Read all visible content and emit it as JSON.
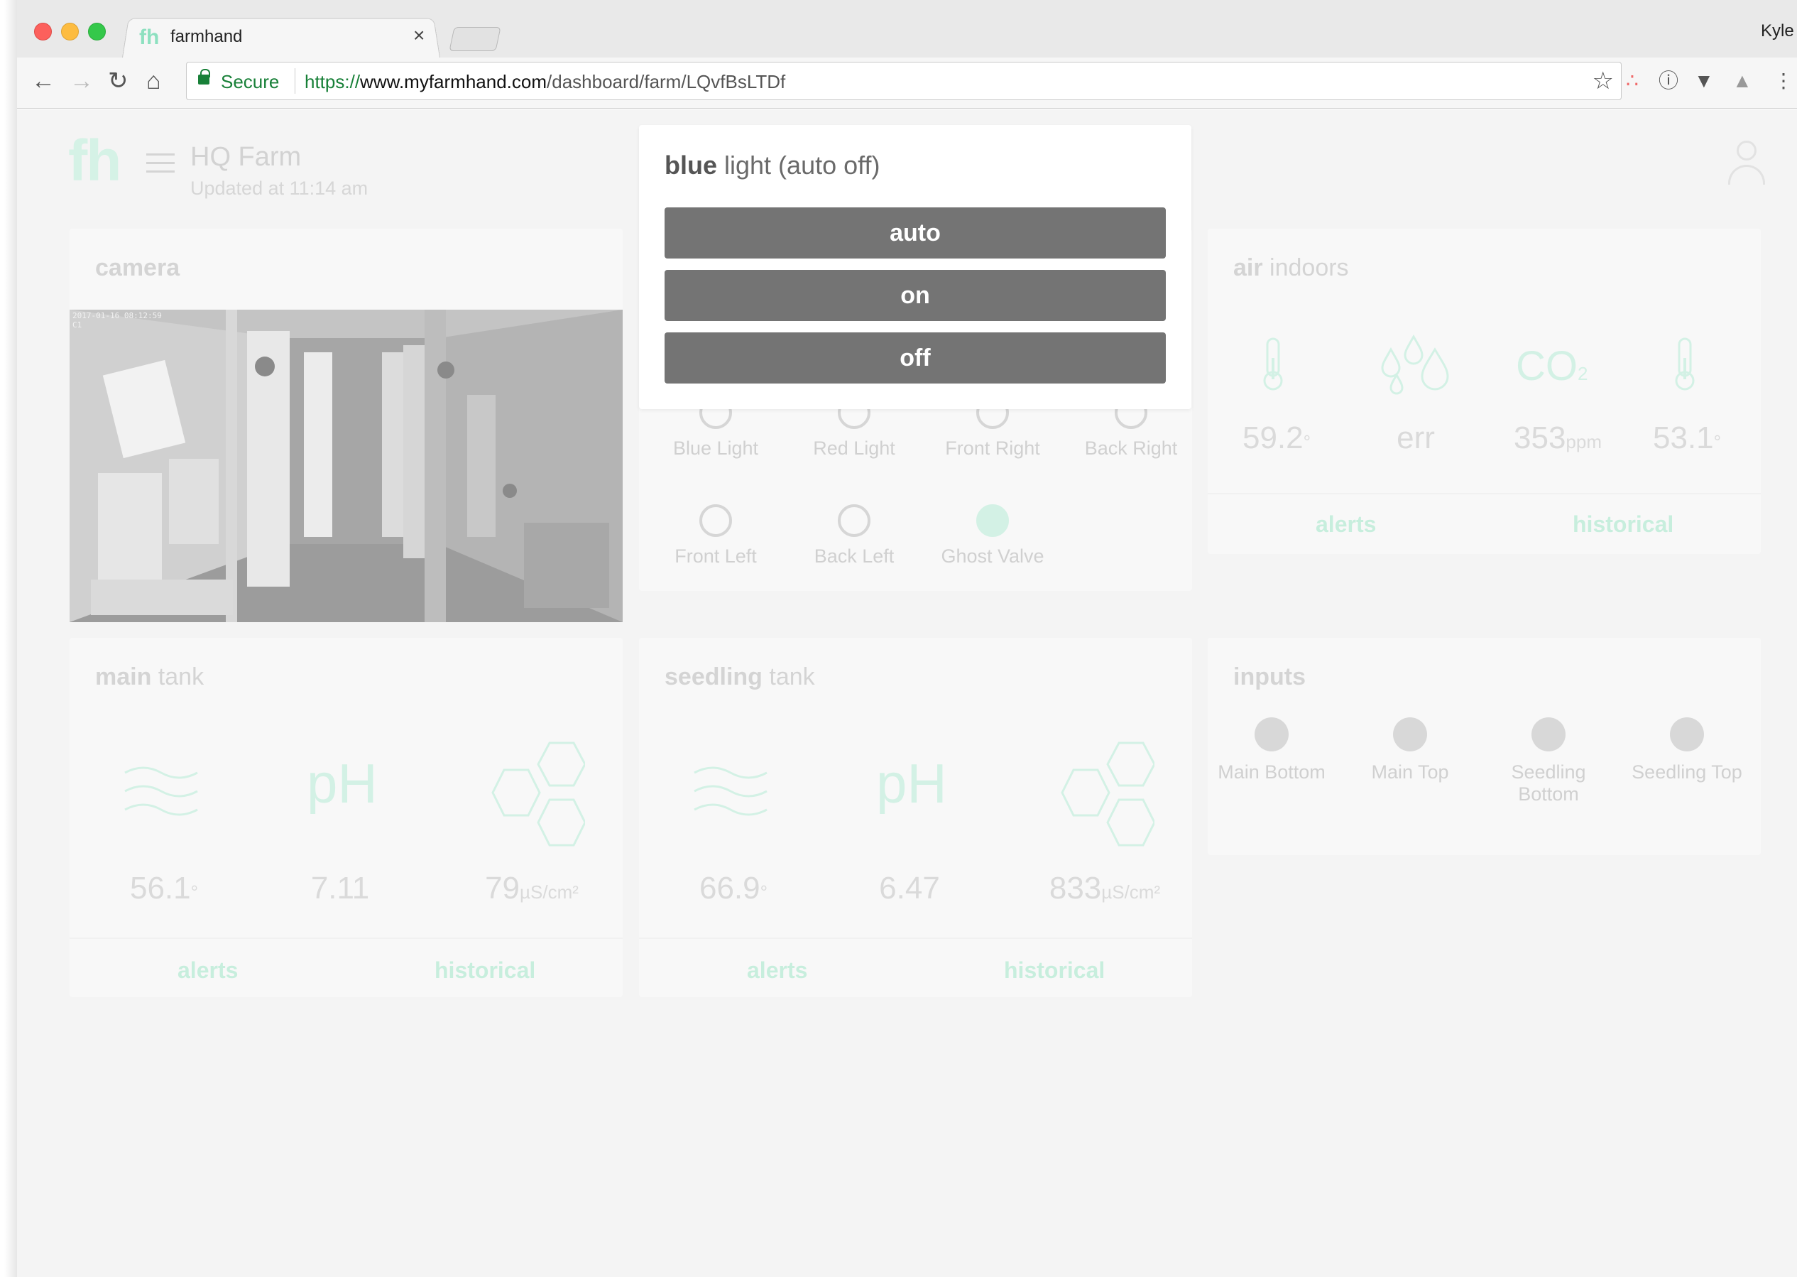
{
  "browser": {
    "tab_title": "farmhand",
    "tab_favicon": "fh",
    "tab_close": "×",
    "user_name": "Kyle",
    "secure_label": "Secure",
    "url_scheme": "https://",
    "url_host": "www.myfarmhand.com",
    "url_path": "/dashboard/farm/LQvfBsLTDf",
    "nav_icons": [
      "back-arrow-icon",
      "forward-arrow-icon",
      "reload-icon",
      "home-icon"
    ],
    "extension_icons": [
      "asana-icon",
      "info-icon",
      "pocket-icon",
      "drive-icon",
      "menu-dots-icon"
    ]
  },
  "header": {
    "logo": "fh",
    "farm_name": "HQ Farm",
    "updated": "Updated at 11:14 am"
  },
  "camera": {
    "title": "camera",
    "timestamp": "2017-01-16 08:12:59",
    "channel": "C1"
  },
  "popup": {
    "title_bold": "blue",
    "title_rest": " light (auto off)",
    "options": [
      "auto",
      "on",
      "off"
    ]
  },
  "relays": {
    "items": [
      {
        "label": "Blue Light",
        "on": false
      },
      {
        "label": "Red Light",
        "on": false
      },
      {
        "label": "Front Right",
        "on": false
      },
      {
        "label": "Back Right",
        "on": false
      },
      {
        "label": "Front Left",
        "on": false
      },
      {
        "label": "Back Left",
        "on": false
      },
      {
        "label": "Ghost Valve",
        "on": true
      }
    ]
  },
  "air": {
    "title_bold": "air",
    "title_rest": " indoors",
    "co2_label": "CO",
    "co2_sub": "2",
    "metrics": [
      {
        "value": "59.2",
        "unit": "°",
        "icon": "thermometer-icon"
      },
      {
        "value": "err",
        "unit": "",
        "icon": "humidity-drops-icon"
      },
      {
        "value": "353",
        "unit": "ppm",
        "icon": "co2-icon"
      },
      {
        "value": "53.1",
        "unit": "°",
        "icon": "thermometer-icon"
      }
    ],
    "alerts": "alerts",
    "historical": "historical"
  },
  "main_tank": {
    "title_bold": "main",
    "title_rest": " tank",
    "ph_label": "pH",
    "temp": {
      "value": "56.1",
      "unit": "°"
    },
    "ph": {
      "value": "7.11"
    },
    "ec": {
      "value": "79",
      "unit": "µS/cm²"
    },
    "alerts": "alerts",
    "historical": "historical"
  },
  "seedling_tank": {
    "title_bold": "seedling",
    "title_rest": " tank",
    "ph_label": "pH",
    "temp": {
      "value": "66.9",
      "unit": "°"
    },
    "ph": {
      "value": "6.47"
    },
    "ec": {
      "value": "833",
      "unit": "µS/cm²"
    },
    "alerts": "alerts",
    "historical": "historical"
  },
  "inputs": {
    "title": "inputs",
    "items": [
      {
        "label": "Main Bottom"
      },
      {
        "label": "Main Top"
      },
      {
        "label": "Seedling Bottom"
      },
      {
        "label": "Seedling Top"
      }
    ]
  },
  "colors": {
    "accent": "#8de0c0",
    "button_gray": "#747474",
    "secure_green": "#188038"
  }
}
